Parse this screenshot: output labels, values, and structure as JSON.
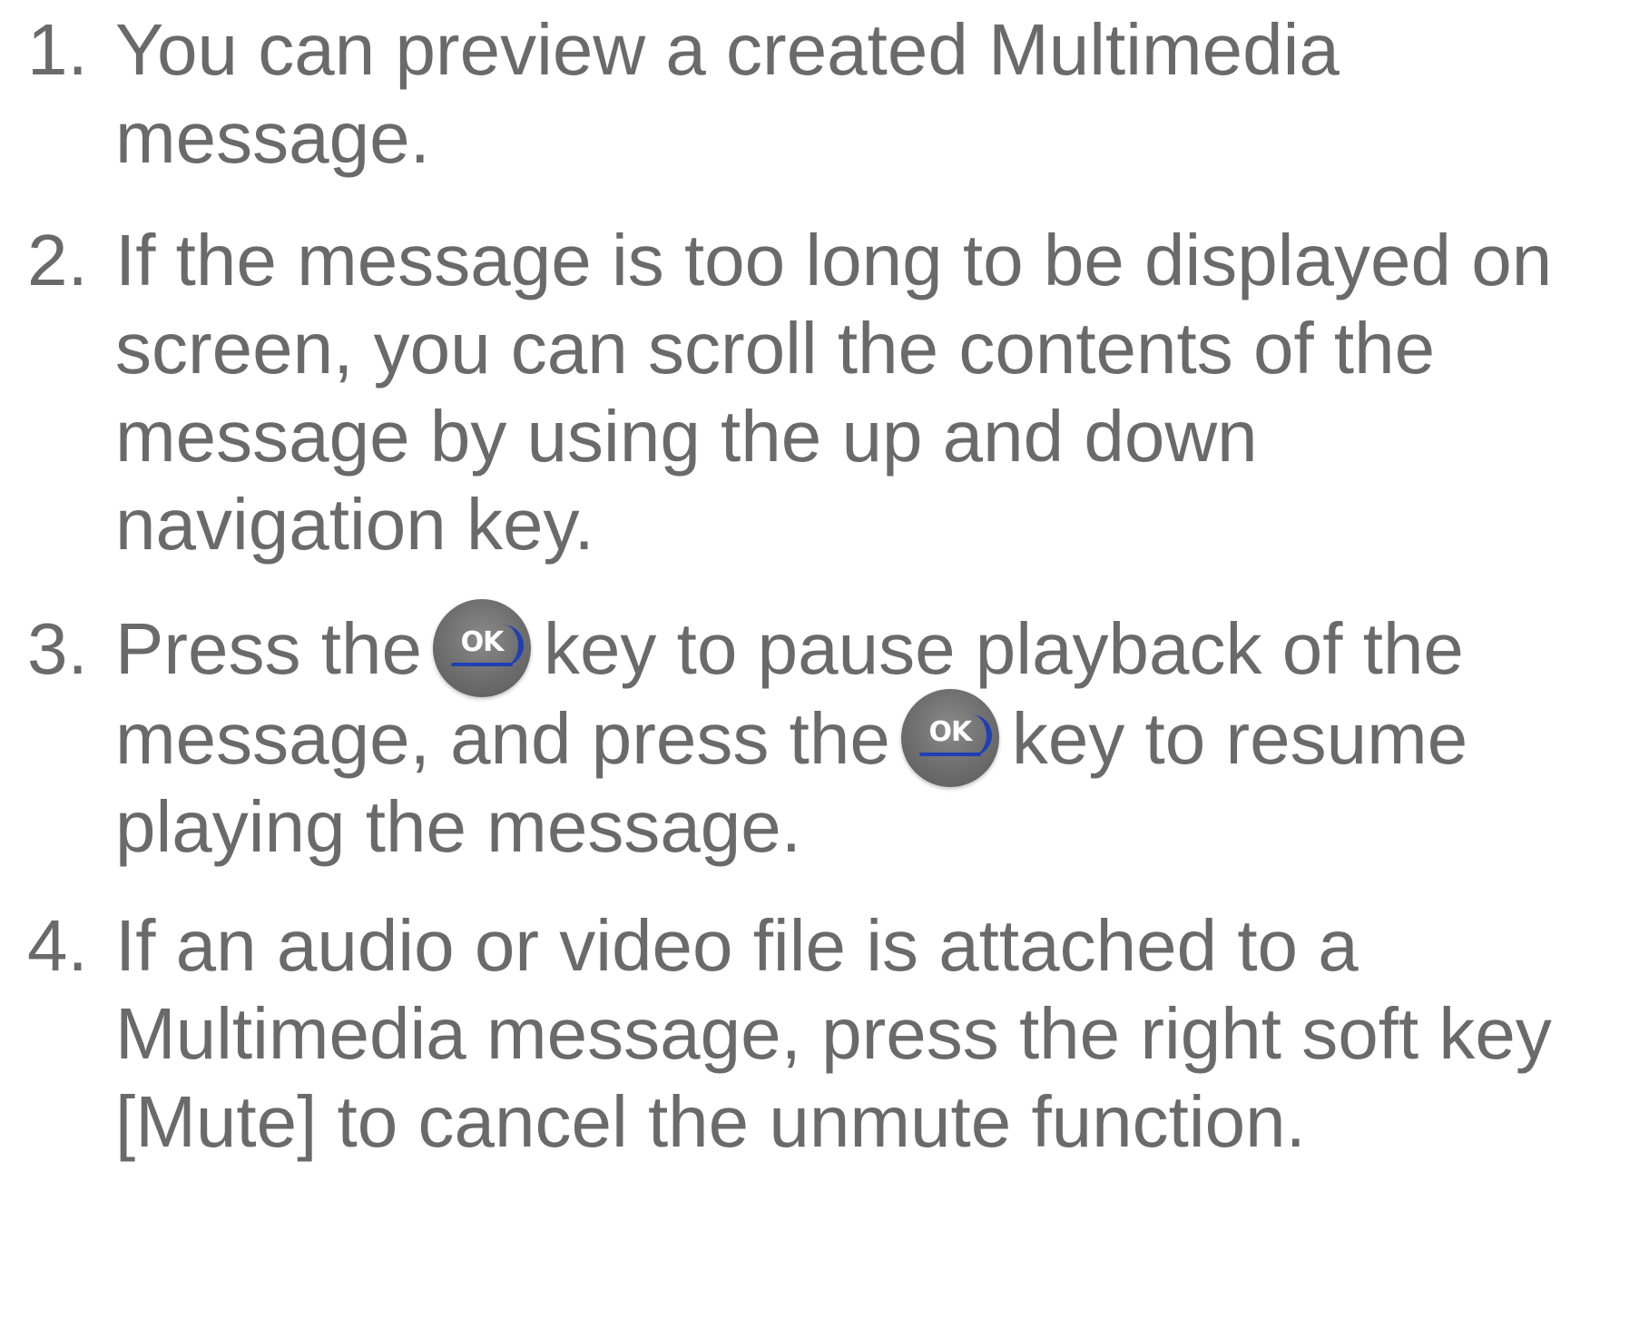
{
  "items": [
    {
      "number": "1.",
      "lines": [
        "You can preview a created Multimedia",
        "message."
      ]
    },
    {
      "number": "2.",
      "lines": [
        "If the message is too long to be displayed on",
        "screen, you can scroll the contents of the",
        "message by using the up and down",
        "navigation key."
      ]
    },
    {
      "number": "3.",
      "line1_before": "Press the",
      "line1_after": "key to pause playback of the",
      "line2_before": "message, and press the",
      "line2_after": "key to resume",
      "line3": "playing the message.",
      "ok_key_icon": "ok-key-icon",
      "ok_label": "OK"
    },
    {
      "number": "4.",
      "lines": [
        "If an audio or video file is attached to a",
        "Multimedia message, press the right soft key",
        "[Mute] to cancel the unmute function."
      ]
    }
  ],
  "colors": {
    "text": "#6a6a6a",
    "ok_key_body": "#6d6d6d",
    "ok_key_accent": "#1f3fb5"
  }
}
